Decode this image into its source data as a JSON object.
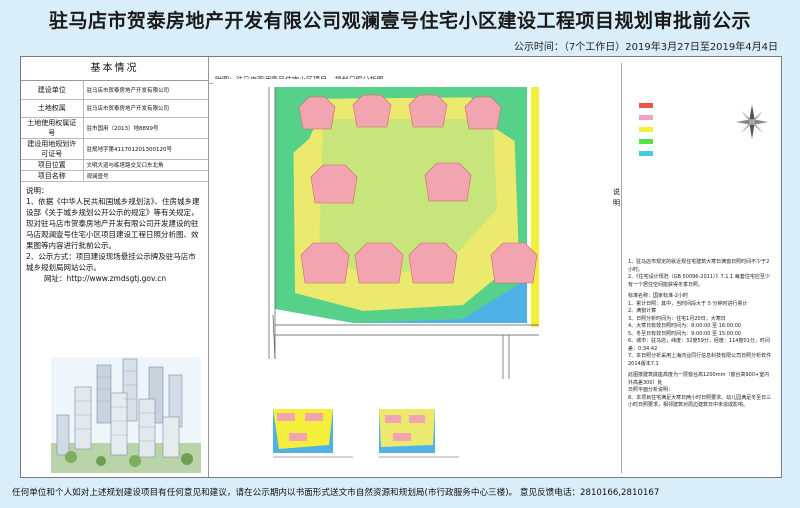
{
  "header": {
    "title": "驻马店市贺泰房地产开发有限公司观澜壹号住宅小区建设工程项目规划审批前公示",
    "publicity_time": "公示时间：（7个工作日）2019年3月27日至2019年4月4日"
  },
  "basic_info": {
    "heading": "基本情况",
    "rows": [
      {
        "label": "建设单位",
        "value": "驻马店市贺泰房地产开发有限公司"
      },
      {
        "label": "土地权属",
        "value": "驻马店市贺泰房地产开发有限公司"
      },
      {
        "label": "土地使用权属证号",
        "value": "驻市国用（2013）地8899号"
      },
      {
        "label": "建设用地规划许可证号",
        "value": "驻规地字第411701201300120号"
      },
      {
        "label": "项目位置",
        "value": "文明大道与练塔路交叉口东北角"
      },
      {
        "label": "项目名称",
        "value": "观澜壹号"
      }
    ]
  },
  "notes": {
    "heading": "说明：",
    "items": [
      "1、依据《中华人民共和国城乡规划法》、住房城乡建设部《关于城乡规划公开公示的规定》等有关规定，现对驻马店市贺泰房地产开发有限公司开发建设的驻马店观澜壹号住宅小区项目建设工程日照分析图、效果图等内容进行批前公示。",
      "2、公示方式：项目建设现场悬挂公示牌及驻马店市城乡规划局网站公示。"
    ],
    "website": "网址：http://www.zmdsgtj.gov.cn"
  },
  "figure": {
    "title": "附图：驻马店观澜壹号住宅小区项目---规划日照分析图",
    "side_label": "说明",
    "description": [
      "1、驻马店市规定的就近规住宅建筑大寒日满窗日照时间不少于2小时。",
      "2、《住宅设计规范（GB 50096-2011）》7.1.1 每套住宅应至少有一个居住空间能获得冬季日照。",
      "标准名称：国家标准-2小时",
      "1、累计日照：其中，当时间段大于 5 分钟时进行累计",
      "2、满窗计算",
      "3、日照分析时间为：住宅1月20日，大寒日",
      "4、大寒日有效日照时间为：8:00:00 至 16:00:00",
      "5、冬至日有效日照时间为：9:00:00 至 15:00:00",
      "6、城市：驻马店，纬度：32度59分，经度：114度01分，时间差：0:34:42",
      "7、本日照分析采用上海鸿业同行信息科技有限公司日照分析软件2014版本7.1",
      "此图按建筑底座高度为一层窗台高1200mm（窗台高900+室内外高差300）处",
      "日照平面分析说明：",
      "8、本项目住宅满足大寒日两小时日照要求。幼儿园满足冬至日三小时日照要求，相邻建筑对周边建筑日中未造成影响。"
    ],
    "legend_colors": [
      "#e8584a",
      "#f2a0c8",
      "#f3ef3a",
      "#58e04a",
      "#47c9e0"
    ]
  },
  "footer": {
    "text": "任何单位和个人如对上述规划建设项目有任何意见和建议，请在公示期内以书面形式送文市自然资源和规划局(市行政服务中心三楼)。     意见反馈电话：2810166,2810167"
  }
}
